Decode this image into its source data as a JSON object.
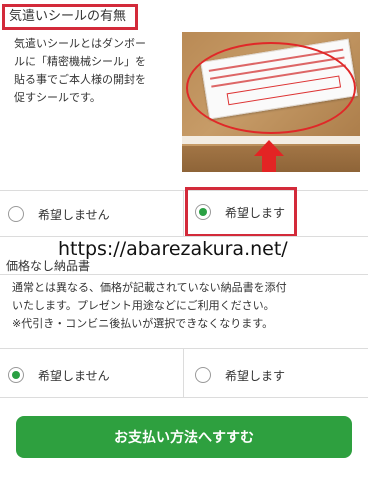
{
  "sticker_section": {
    "title": "気遣いシールの有無",
    "description_lines": [
      "気遣いシールとはダンボー",
      "ルに「精密機械シール」を",
      "貼る事でご本人様の開封を",
      "促すシールです。"
    ],
    "options": [
      {
        "label": "希望しません",
        "selected": false
      },
      {
        "label": "希望します",
        "selected": true
      }
    ]
  },
  "watermark": "https://abarezakura.net/",
  "invoice_section": {
    "title": "価格なし納品書",
    "description_lines": [
      "通常とは異なる、価格が記載されていない納品書を添付",
      "いたします。プレゼント用途などにご利用ください。",
      "※代引き・コンビニ後払いが選択できなくなります。"
    ],
    "options": [
      {
        "label": "希望しません",
        "selected": true
      },
      {
        "label": "希望します",
        "selected": false
      }
    ]
  },
  "pay_button": "お支払い方法へすすむ",
  "colors": {
    "accent_green": "#2ea03f",
    "highlight_red": "#d32a3a"
  }
}
